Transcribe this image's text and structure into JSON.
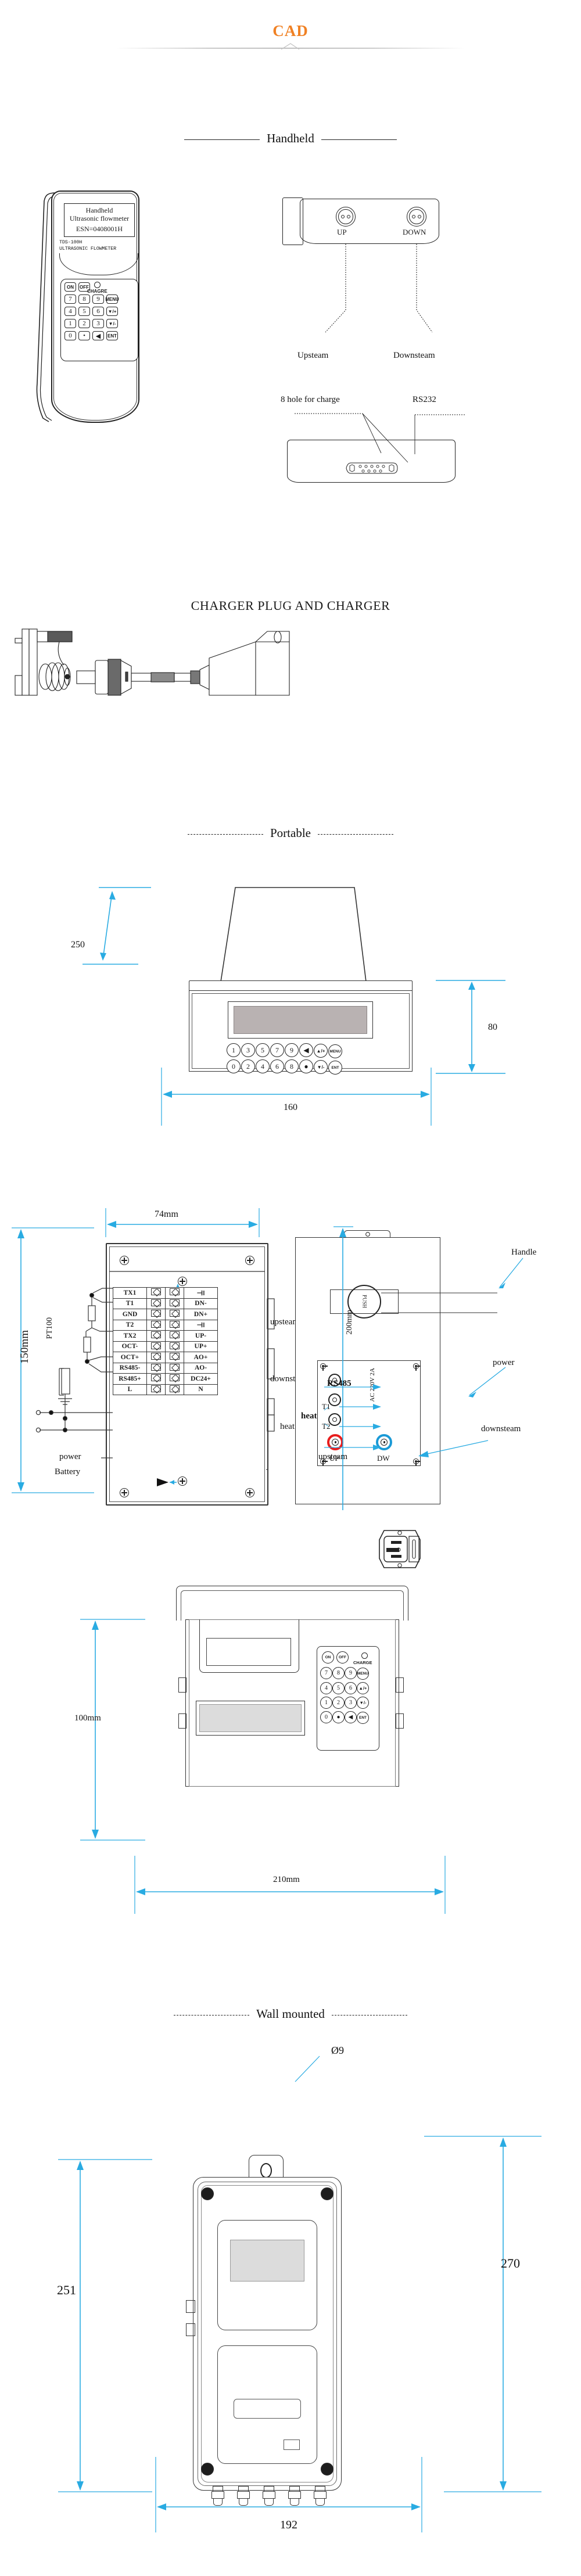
{
  "page": {
    "title": "CAD",
    "accent_color": "#F08124",
    "dim_color": "#29ABE2",
    "line_color": "#222222"
  },
  "sections": {
    "handheld": {
      "label": "Handheld"
    },
    "charger": {
      "label": "CHARGER PLUG AND CHARGER"
    },
    "portable": {
      "label": "Portable"
    },
    "wall": {
      "label": "Wall mounted"
    }
  },
  "handheld": {
    "screen": {
      "line1": "Handheld",
      "line2": "Ultrasonic flowmeter",
      "line3": "ESN=0408001H"
    },
    "model_line1": "TDS-100H",
    "model_line2": "ULTRASONIC FLOWMETER",
    "charge_led_label": "CHAGRE",
    "keys": {
      "row0": [
        "ON",
        "OFF"
      ],
      "row1": [
        "7",
        "8",
        "9",
        "MENU"
      ],
      "row2": [
        "4",
        "5",
        "6",
        "▼/+"
      ],
      "row3": [
        "1",
        "2",
        "3",
        "▼/-"
      ],
      "row4": [
        "0",
        "•",
        "◀",
        "ENT"
      ]
    },
    "top_view": {
      "connector_up": "UP",
      "connector_down": "DOWN",
      "callout_upstream": "Upsteam",
      "callout_downstream": "Downsteam"
    },
    "rs232_view": {
      "callout_charge": "8 hole for charge",
      "callout_rs232": "RS232"
    }
  },
  "portable": {
    "dimensions": {
      "depth": "250",
      "height": "80",
      "width": "160"
    },
    "keys_row1": [
      "1",
      "3",
      "5",
      "7",
      "9",
      "◀",
      "▲/+",
      "MENU"
    ],
    "keys_row2": [
      "0",
      "2",
      "4",
      "6",
      "8",
      "●",
      "▼/-",
      "ENT"
    ]
  },
  "terminal_block": {
    "dim_width": "74mm",
    "dim_height": "150mm",
    "left_terminals": [
      "TX1",
      "T1",
      "GND",
      "T2",
      "TX2",
      "OCT-",
      "OCT+",
      "RS485-",
      "RS485+",
      "L"
    ],
    "right_terminals": [
      "⊣‖",
      "DN-",
      "DN+",
      "⊣‖",
      "UP-",
      "UP+",
      "AO+",
      "AO-",
      "DC24+",
      "N"
    ],
    "left_callouts": [
      "PT100",
      "power",
      "Battery"
    ],
    "right_callouts": [
      "upsteam",
      "downsteam",
      "heat"
    ]
  },
  "side_panel": {
    "dim_height": "200mm",
    "push_button": "PUSH",
    "ac_label": "AC 220V 2A",
    "jack_labels": {
      "rs485": "RS485",
      "t1": "T1",
      "t2": "T2",
      "heat": "heat"
    },
    "bnc_up": "UP",
    "bnc_dw": "DW",
    "callouts": {
      "handle": "Handle",
      "power": "power",
      "downstream": "downsteam",
      "upstream": "upsteam"
    }
  },
  "printer_unit": {
    "dim_height": "100mm",
    "dim_width": "210mm",
    "charge_label": "CHARGE",
    "keys": {
      "row0": [
        "ON",
        "OFF"
      ],
      "row1": [
        "7",
        "8",
        "9",
        "MENU"
      ],
      "row2": [
        "4",
        "5",
        "6",
        "▲/+"
      ],
      "row3": [
        "1",
        "2",
        "3",
        "▼/-"
      ],
      "row4": [
        "0",
        "●",
        "◀",
        "ENT"
      ]
    }
  },
  "wall_mounted": {
    "hole_callout": "Ø9",
    "dim_left": "251",
    "dim_right": "270",
    "dim_bottom": "192"
  }
}
